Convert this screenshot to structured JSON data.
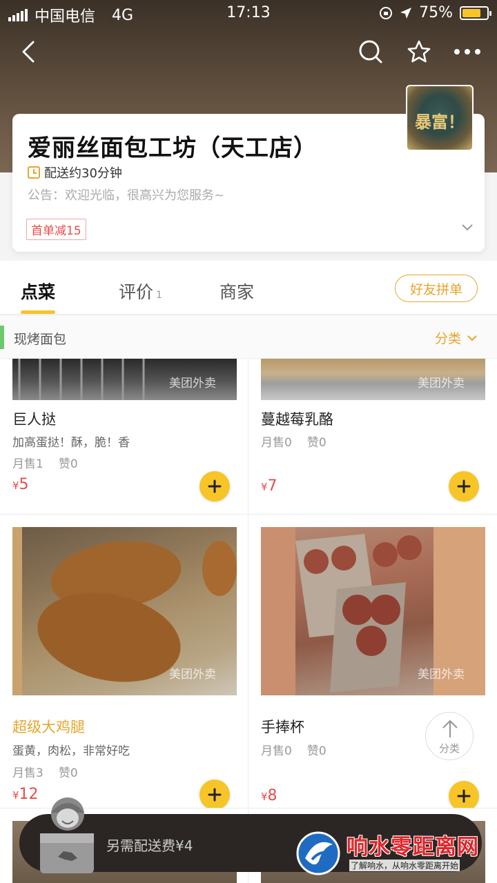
{
  "status_bar": {
    "carrier": "中国电信",
    "network": "4G",
    "time": "17:13",
    "battery": "75%",
    "battery_level": 0.75
  },
  "nav": {
    "icons": [
      "back-icon",
      "search-icon",
      "star-icon",
      "more-icon"
    ]
  },
  "shop": {
    "name": "爱丽丝面包工坊（天工店）",
    "logo_text": "暴富！",
    "delivery": "配送约30分钟",
    "notice": "公告：欢迎光临，很高兴为您服务~",
    "promo": "首单减15"
  },
  "tabs": {
    "order": "点菜",
    "reviews": "评价",
    "reviews_count": "1",
    "merchant": "商家",
    "group_order": "好友拼单"
  },
  "category": {
    "name": "现烤面包",
    "filter": "分类"
  },
  "products": [
    {
      "name": "巨人挞",
      "desc": "加高蛋挞！酥，脆！香",
      "sold": "月售1",
      "likes": "赞0",
      "price": "5",
      "watermark": "美团外卖"
    },
    {
      "name": "蔓越莓乳酪",
      "desc": "",
      "sold": "月售0",
      "likes": "赞0",
      "price": "7",
      "watermark": "美团外卖"
    },
    {
      "name": "超级大鸡腿",
      "desc": "蛋黄，肉松，非常好吃",
      "sold": "月售3",
      "likes": "赞0",
      "price": "12",
      "watermark": "美团外卖"
    },
    {
      "name": "手捧杯",
      "desc": "",
      "sold": "月售0",
      "likes": "赞0",
      "price": "8",
      "watermark": "美团外卖"
    }
  ],
  "currency": "¥",
  "up_button": "分类",
  "cart": {
    "fee": "另需配送费¥4"
  },
  "brand": {
    "name": "响水零距离网",
    "slogan": "了解响水，从响水零距离开始"
  },
  "colors": {
    "accent": "#f7c528",
    "price": "#e84b4b",
    "highlight": "#e7a52c"
  }
}
